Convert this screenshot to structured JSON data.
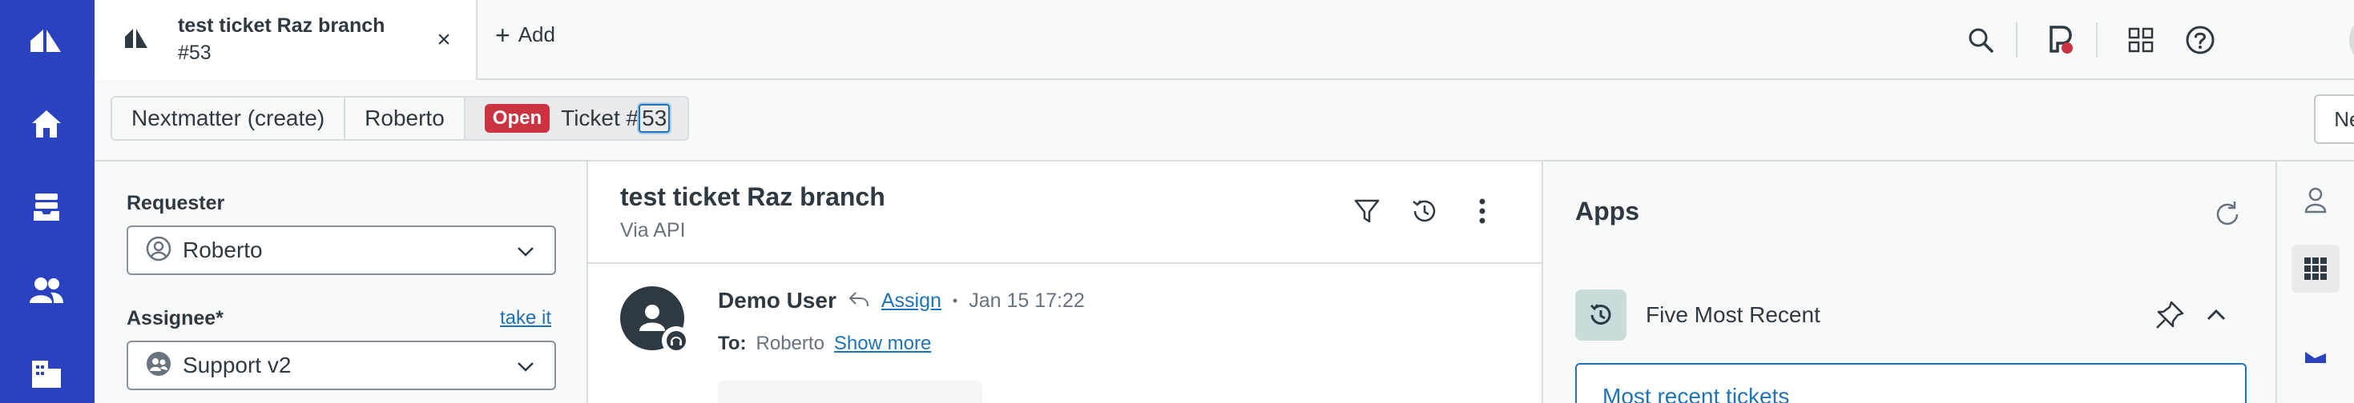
{
  "nav": {
    "icons": [
      "zendesk-logo-icon",
      "home-icon",
      "views-icon",
      "customers-icon",
      "organizations-icon"
    ]
  },
  "tab": {
    "title": "test ticket Raz branch",
    "subtitle": "#53",
    "close": "×"
  },
  "add": {
    "plus": "+",
    "label": "Add"
  },
  "topbar": {
    "icons": [
      "search-icon",
      "conversations-icon",
      "apps-grid-icon",
      "help-icon",
      "profile-avatar-icon"
    ],
    "colors": {
      "status_dot": "#cc3340"
    }
  },
  "breadcrumb": {
    "items": [
      "Nextmatter (create)",
      "Roberto"
    ],
    "status_badge": "Open",
    "ticket_prefix": "Ticket #",
    "ticket_number": "53"
  },
  "next_button": {
    "label": "Next"
  },
  "properties": {
    "requester": {
      "label": "Requester",
      "value": "Roberto"
    },
    "assignee": {
      "label": "Assignee*",
      "take_it": "take it",
      "value": "Support v2"
    }
  },
  "conversation": {
    "title": "test ticket Raz branch",
    "via": "Via API",
    "message": {
      "author": "Demo User",
      "assign_label": "Assign",
      "separator": "•",
      "timestamp": "Jan 15 17:22",
      "to_label": "To:",
      "to_value": "Roberto",
      "show_more": "Show more"
    }
  },
  "apps": {
    "title": "Apps",
    "app_name": "Five Most Recent",
    "link": "Most recent tickets"
  },
  "right_rail": {
    "icons": [
      "user-icon",
      "apps-grid-icon",
      "chart-icon"
    ]
  },
  "colors": {
    "nav_bg": "#2a41c0",
    "link": "#1f73b7",
    "badge_open": "#cc3340"
  }
}
